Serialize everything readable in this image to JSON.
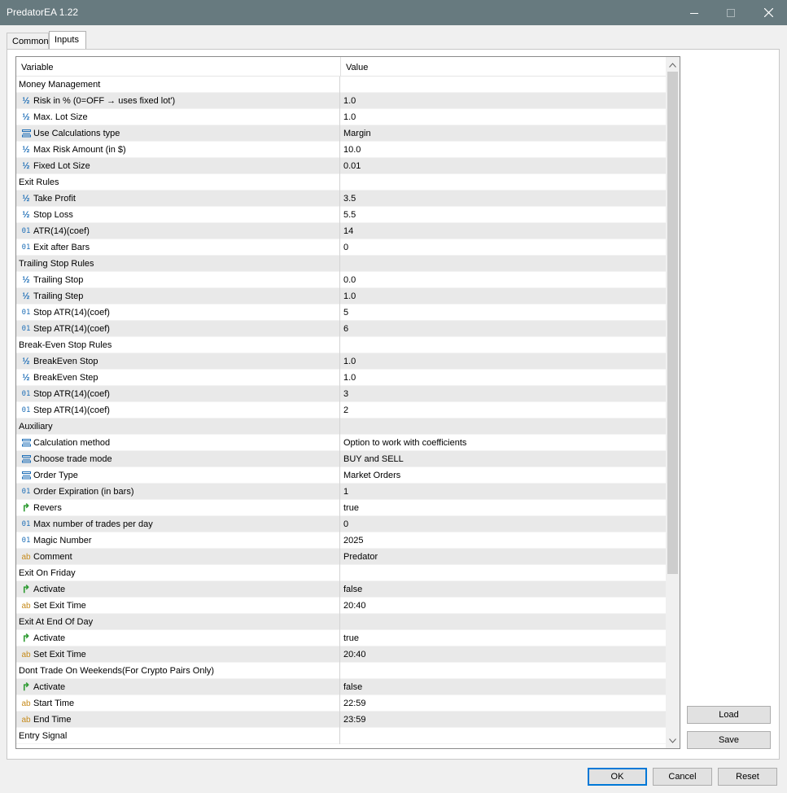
{
  "window": {
    "title": "PredatorEA 1.22"
  },
  "tabs": [
    {
      "label": "Common"
    },
    {
      "label": "Inputs"
    }
  ],
  "grid": {
    "columns": {
      "variable": "Variable",
      "value": "Value"
    },
    "rows": [
      {
        "type": "section",
        "name": "Money Management",
        "value": ""
      },
      {
        "type": "double",
        "name": "Risk in % (0=OFF → uses fixed lot')",
        "value": "1.0"
      },
      {
        "type": "double",
        "name": "Max. Lot Size",
        "value": "1.0"
      },
      {
        "type": "enum",
        "name": "Use Calculations type",
        "value": "Margin"
      },
      {
        "type": "double",
        "name": "Max Risk Amount (in $)",
        "value": "10.0"
      },
      {
        "type": "double",
        "name": "Fixed Lot Size",
        "value": "0.01"
      },
      {
        "type": "section",
        "name": "Exit Rules",
        "value": ""
      },
      {
        "type": "double",
        "name": "Take Profit",
        "value": "3.5"
      },
      {
        "type": "double",
        "name": "Stop Loss",
        "value": "5.5"
      },
      {
        "type": "int",
        "name": "ATR(14)(coef)",
        "value": "14"
      },
      {
        "type": "int",
        "name": "Exit after Bars",
        "value": "0"
      },
      {
        "type": "section",
        "name": "Trailing Stop Rules",
        "value": ""
      },
      {
        "type": "double",
        "name": "Trailing Stop",
        "value": "0.0"
      },
      {
        "type": "double",
        "name": "Trailing Step",
        "value": "1.0"
      },
      {
        "type": "int",
        "name": "Stop ATR(14)(coef)",
        "value": "5"
      },
      {
        "type": "int",
        "name": "Step ATR(14)(coef)",
        "value": "6"
      },
      {
        "type": "section",
        "name": "Break-Even Stop Rules",
        "value": ""
      },
      {
        "type": "double",
        "name": "BreakEven Stop",
        "value": "1.0"
      },
      {
        "type": "double",
        "name": "BreakEven Step",
        "value": "1.0"
      },
      {
        "type": "int",
        "name": "Stop ATR(14)(coef)",
        "value": "3"
      },
      {
        "type": "int",
        "name": "Step ATR(14)(coef)",
        "value": "2"
      },
      {
        "type": "section",
        "name": "Auxiliary",
        "value": ""
      },
      {
        "type": "enum",
        "name": "Calculation method",
        "value": "Option to work with coefficients"
      },
      {
        "type": "enum",
        "name": "Choose trade mode",
        "value": "BUY and SELL"
      },
      {
        "type": "enum",
        "name": "Order Type",
        "value": "Market Orders"
      },
      {
        "type": "int",
        "name": "Order Expiration (in bars)",
        "value": "1"
      },
      {
        "type": "bool",
        "name": "Revers",
        "value": "true"
      },
      {
        "type": "int",
        "name": "Max number of trades per day",
        "value": "0"
      },
      {
        "type": "int",
        "name": "Magic Number",
        "value": "2025"
      },
      {
        "type": "string",
        "name": "Comment",
        "value": "Predator"
      },
      {
        "type": "section",
        "name": "Exit On Friday",
        "value": ""
      },
      {
        "type": "bool",
        "name": "Activate",
        "value": "false"
      },
      {
        "type": "string",
        "name": "Set Exit Time",
        "value": "20:40"
      },
      {
        "type": "section",
        "name": "Exit At End Of Day",
        "value": ""
      },
      {
        "type": "bool",
        "name": "Activate",
        "value": "true"
      },
      {
        "type": "string",
        "name": "Set Exit Time",
        "value": "20:40"
      },
      {
        "type": "section",
        "name": "Dont Trade On Weekends(For Crypto Pairs Only)",
        "value": ""
      },
      {
        "type": "bool",
        "name": "Activate",
        "value": "false"
      },
      {
        "type": "string",
        "name": "Start Time",
        "value": "22:59"
      },
      {
        "type": "string",
        "name": "End Time",
        "value": "23:59"
      },
      {
        "type": "section",
        "name": "Entry Signal",
        "value": ""
      }
    ]
  },
  "side_buttons": {
    "load": "Load",
    "save": "Save"
  },
  "footer_buttons": {
    "ok": "OK",
    "cancel": "Cancel",
    "reset": "Reset"
  },
  "icons": {
    "double": "fraction-icon",
    "int": "integer-icon",
    "enum": "list-icon",
    "bool": "boolean-icon",
    "string": "string-icon"
  },
  "colors": {
    "titlebar": "#677a7f",
    "numeric_icon": "#1f6fb7",
    "string_icon": "#c68b1c",
    "bool_icon": "#2e9b32",
    "alt_row": "#e9e9e9",
    "default_button_border": "#0078d7"
  }
}
